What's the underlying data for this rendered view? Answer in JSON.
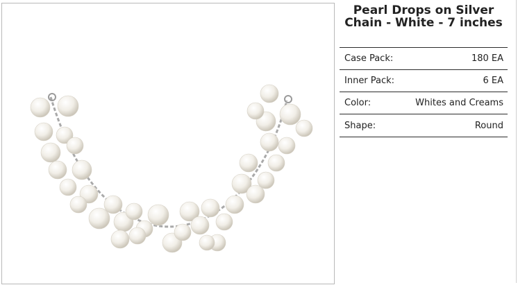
{
  "product": {
    "title": "Pearl Drops on Silver Chain - White - 7 inches",
    "image_alt": "pearl-drop-necklace"
  },
  "attributes": [
    {
      "label": "Case Pack:",
      "value": "180 EA"
    },
    {
      "label": "Inner Pack:",
      "value": "6 EA"
    },
    {
      "label": "Color:",
      "value": "Whites and Creams"
    },
    {
      "label": "Shape:",
      "value": "Round"
    }
  ],
  "colors": {
    "pearl": "#f4f2ec",
    "pearl_shadow": "#cfc9bd",
    "chain": "#a9a9a9",
    "border": "#2b2b2b"
  }
}
